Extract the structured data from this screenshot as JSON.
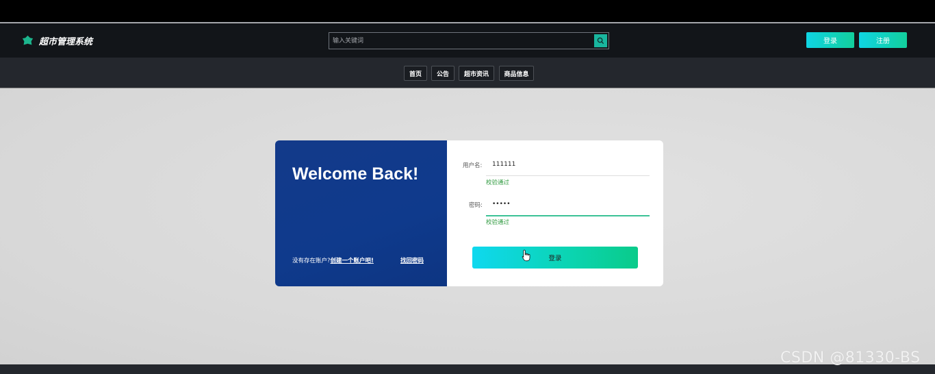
{
  "header": {
    "app_title": "超市管理系统",
    "search_placeholder": "输入关键词",
    "login_label": "登录",
    "register_label": "注册"
  },
  "nav": {
    "items": [
      "首页",
      "公告",
      "超市资讯",
      "商品信息"
    ]
  },
  "card": {
    "welcome": "Welcome Back!",
    "no_account_text": "没有存在账户?",
    "create_account_link": "创建一个账户吧!",
    "forgot_link": "找回密码",
    "username_label": "用户名:",
    "username_value": "111111",
    "username_hint": "校验通过",
    "password_label": "密码:",
    "password_value": "•••••",
    "password_hint": "校验通过",
    "login_button": "登录"
  },
  "watermark": "CSDN @81330-BS",
  "colors": {
    "accent_start": "#0fd4e3",
    "accent_end": "#12cf9c",
    "card_left": "#0f3a8c",
    "hint_green": "#2f9a3f"
  }
}
